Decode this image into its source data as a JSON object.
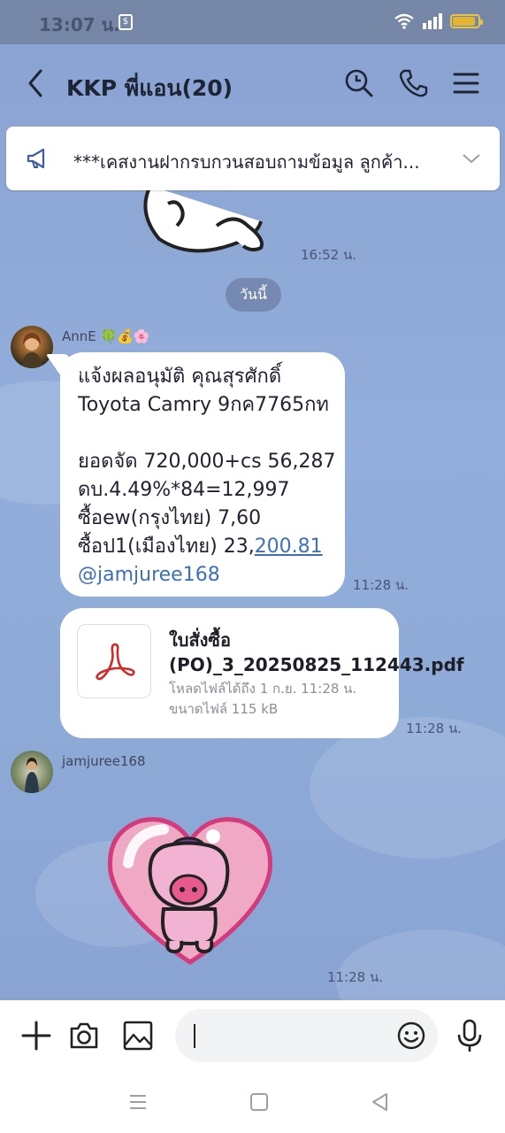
{
  "status_bar": {
    "time": "13:07 น.",
    "notification_icon": "shopping-bag-icon",
    "battery_level_percent": 90
  },
  "header": {
    "title": "KKP พี่แอน(20)"
  },
  "announcement": {
    "text": "***เคสงานฝากรบกวนสอบถามข้อมูล ลูกค้า..."
  },
  "messages": {
    "sticker_time": "16:52 น.",
    "date_separator": "วันนี้",
    "msg1": {
      "sender": "AnnE 🍀💰🌸",
      "lines": [
        "แจ้งผลอนุมัติ คุณสุรศักดิ์",
        "Toyota Camry 9กค7765กท",
        "",
        "ยอดจัด 720,000+cs 56,287",
        "ดบ.4.49%*84=12,997",
        "ซื้อew(กรุงไทย) 7,60",
        "ซื้อป1(เมืองไทย) 23,"
      ],
      "link_text": "200.81",
      "mention": "@jamjuree168",
      "time": "11:28 น."
    },
    "msg2": {
      "file_name": "ใบสั่งซื้อ (PO)_3_20250825_112443.pdf",
      "meta_line1": "โหลดไฟล์ได้ถึง 1 ก.ย. 11:28 น.",
      "meta_line2": "ขนาดไฟล์ 115 kB",
      "time": "11:28 น."
    },
    "msg3": {
      "sender": "jamjuree168",
      "time": "11:28 น."
    }
  },
  "colors": {
    "chat_bg": "#8fa6d0",
    "link": "#3d6fbf",
    "header_bar": "#7686a6",
    "pdf_red": "#d02a2a"
  }
}
